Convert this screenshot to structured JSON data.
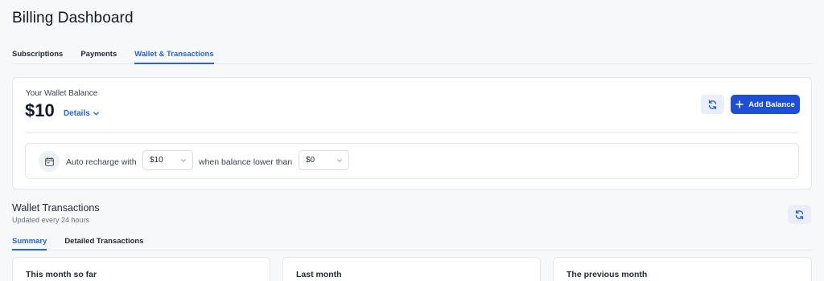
{
  "page": {
    "title": "Billing Dashboard"
  },
  "top_tabs": [
    {
      "label": "Subscriptions",
      "active": false
    },
    {
      "label": "Payments",
      "active": false
    },
    {
      "label": "Wallet & Transactions",
      "active": true
    }
  ],
  "wallet": {
    "balance_label": "Your Wallet Balance",
    "balance_value": "$10",
    "details_label": "Details",
    "add_balance_label": "Add Balance"
  },
  "recharge": {
    "prefix": "Auto recharge with",
    "amount_value": "$10",
    "middle": "when balance lower than",
    "threshold_value": "$0"
  },
  "transactions": {
    "title": "Wallet Transactions",
    "subtitle": "Updated every 24 hours",
    "tabs": [
      {
        "label": "Summary",
        "active": true
      },
      {
        "label": "Detailed Transactions",
        "active": false
      }
    ],
    "cards": [
      {
        "title": "This month so far"
      },
      {
        "title": "Last month"
      },
      {
        "title": "The previous month"
      }
    ]
  },
  "colors": {
    "accent": "#2563eb",
    "button": "#1d4ed8",
    "background": "#f7f8fa"
  },
  "icons": [
    "refresh-icon",
    "plus-icon",
    "chevron-down-icon",
    "calendar-icon"
  ]
}
